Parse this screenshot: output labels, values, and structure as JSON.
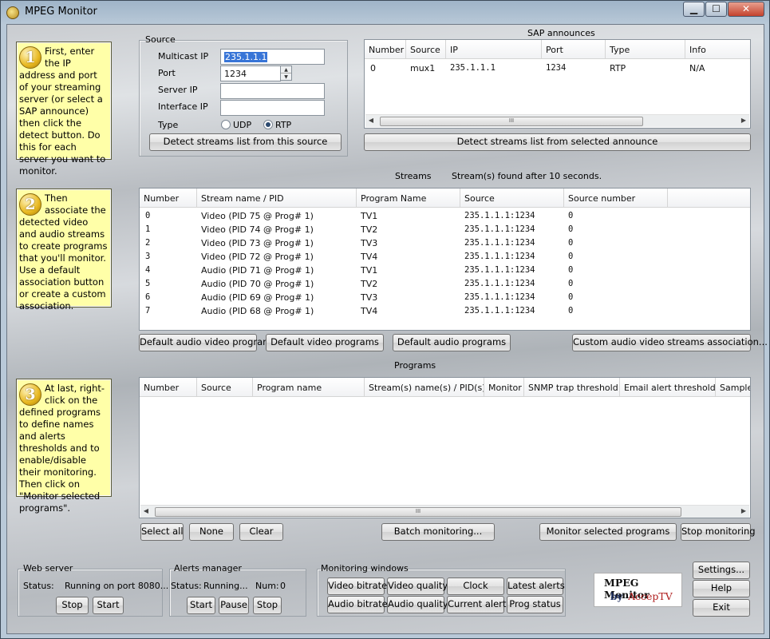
{
  "window": {
    "title": "MPEG Monitor",
    "minimize": "▁",
    "maximize": "☐",
    "close": "✕"
  },
  "help": {
    "step1": {
      "num": "1",
      "text": "First, enter the IP address and port of your streaming server (or select a SAP announce) then click the detect button. Do this for each server you want to monitor."
    },
    "step2": {
      "num": "2",
      "text": "Then associate the detected video and audio streams to create programs that you'll monitor. Use a default association button or create a custom association."
    },
    "step3": {
      "num": "3",
      "text": "At last, right-click on the defined programs to define names and alerts thresholds and to enable/disable their monitoring. Then click on \"Monitor selected programs\"."
    }
  },
  "source": {
    "title": "Source",
    "multicast_label": "Multicast IP",
    "multicast_value": "235.1.1.1",
    "port_label": "Port",
    "port_value": "1234",
    "server_label": "Server IP",
    "server_value": "",
    "interface_label": "Interface IP",
    "interface_value": "",
    "type_label": "Type",
    "udp": "UDP",
    "rtp": "RTP",
    "detect_btn": "Detect streams list from this source"
  },
  "sap": {
    "title": "SAP announces",
    "columns": [
      "Number",
      "Source",
      "IP",
      "Port",
      "Type",
      "Info"
    ],
    "rows": [
      [
        "0",
        "mux1",
        "235.1.1.1",
        "1234",
        "RTP",
        "N/A"
      ]
    ],
    "detect_btn": "Detect streams list from selected announce"
  },
  "streams": {
    "title": "Streams",
    "status": "Stream(s) found after 10 seconds.",
    "columns": [
      "Number",
      "Stream name / PID",
      "Program Name",
      "Source",
      "Source number"
    ],
    "rows": [
      [
        "0",
        "Video (PID 75 @ Prog# 1)",
        "TV1",
        "235.1.1.1:1234",
        "0"
      ],
      [
        "1",
        "Video (PID 74 @ Prog# 1)",
        "TV2",
        "235.1.1.1:1234",
        "0"
      ],
      [
        "2",
        "Video (PID 73 @ Prog# 1)",
        "TV3",
        "235.1.1.1:1234",
        "0"
      ],
      [
        "3",
        "Video (PID 72 @ Prog# 1)",
        "TV4",
        "235.1.1.1:1234",
        "0"
      ],
      [
        "4",
        "Audio (PID 71 @ Prog# 1)",
        "TV1",
        "235.1.1.1:1234",
        "0"
      ],
      [
        "5",
        "Audio (PID 70 @ Prog# 1)",
        "TV2",
        "235.1.1.1:1234",
        "0"
      ],
      [
        "6",
        "Audio (PID 69 @ Prog# 1)",
        "TV3",
        "235.1.1.1:1234",
        "0"
      ],
      [
        "7",
        "Audio (PID 68 @ Prog# 1)",
        "TV4",
        "235.1.1.1:1234",
        "0"
      ]
    ],
    "btn_default_av": "Default audio video programs",
    "btn_default_video": "Default video programs",
    "btn_default_audio": "Default audio programs",
    "btn_custom": "Custom audio video streams association..."
  },
  "programs": {
    "title": "Programs",
    "columns": [
      "Number",
      "Source",
      "Program name",
      "Stream(s) name(s) / PID(s)",
      "Monitor",
      "SNMP trap threshold",
      "Email alert threshold",
      "Sample"
    ],
    "btn_select_all": "Select all",
    "btn_none": "None",
    "btn_clear": "Clear",
    "btn_batch": "Batch monitoring...",
    "btn_monitor": "Monitor selected programs",
    "btn_stop": "Stop monitoring"
  },
  "webserver": {
    "title": "Web server",
    "status_label": "Status:",
    "status_value": "Running on port 8080...",
    "stop": "Stop",
    "start": "Start"
  },
  "alerts": {
    "title": "Alerts manager",
    "status_label": "Status:",
    "status_value": "Running...",
    "num_label": "Num:",
    "num_value": "0",
    "start": "Start",
    "pause": "Pause",
    "stop": "Stop"
  },
  "monitoring": {
    "title": "Monitoring windows",
    "video_bitrate": "Video bitrate",
    "video_quality": "Video quality",
    "clock": "Clock",
    "latest_alerts": "Latest alerts",
    "audio_bitrate": "Audio bitrate",
    "audio_quality": "Audio quality",
    "current_alerts": "Current alerts",
    "prog_status": "Prog status"
  },
  "logo": {
    "line1": "MPEG Monitor",
    "by": "by",
    "brand": "AccepTV"
  },
  "side": {
    "settings": "Settings...",
    "help": "Help",
    "exit": "Exit"
  },
  "scroll_grip": "III"
}
